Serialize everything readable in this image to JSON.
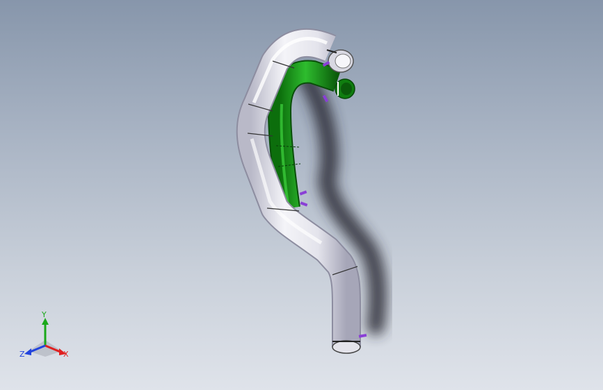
{
  "viewport": {
    "background_top": "#8796ab",
    "background_bottom": "#dfe3ea"
  },
  "model": {
    "gray_pipe_color": "#e6e6ee",
    "green_pipe_color": "#169a16",
    "clip_color": "#8a3fd6"
  },
  "triad": {
    "x_label": "X",
    "y_label": "Y",
    "z_label": "Z",
    "x_color": "#e02020",
    "y_color": "#1aa81a",
    "z_color": "#2244dd"
  }
}
